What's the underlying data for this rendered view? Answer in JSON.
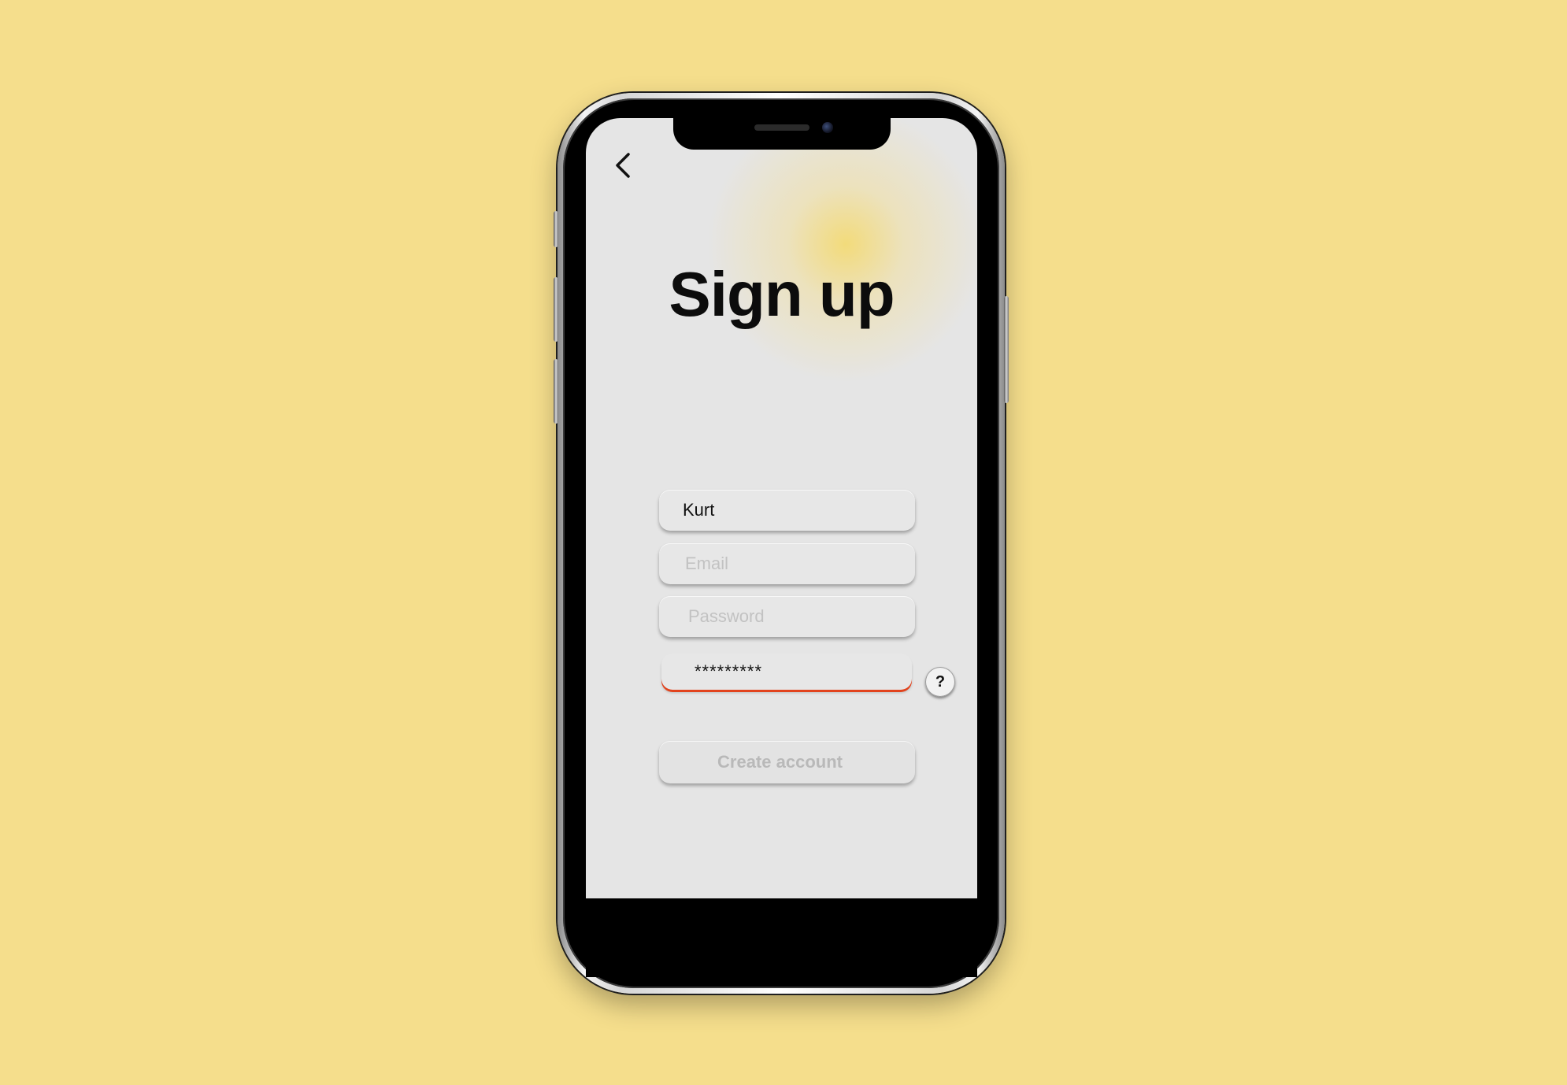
{
  "theme": {
    "background": "#f5de8c",
    "screen_background": "#e5e5e5",
    "accent_glow": "#f5d968",
    "error_underline": "#e2431d",
    "disabled_text": "#b9b9b9"
  },
  "header": {
    "back_icon": "chevron-left-icon"
  },
  "page": {
    "title": "Sign up"
  },
  "form": {
    "name": {
      "value": "Kurt",
      "placeholder": ""
    },
    "email": {
      "value": "",
      "placeholder": "Email"
    },
    "password": {
      "value": "",
      "placeholder": "Password"
    },
    "confirm": {
      "value": "*********",
      "state": "error"
    },
    "help_label": "?",
    "submit_label": "Create account",
    "submit_state": "disabled"
  }
}
